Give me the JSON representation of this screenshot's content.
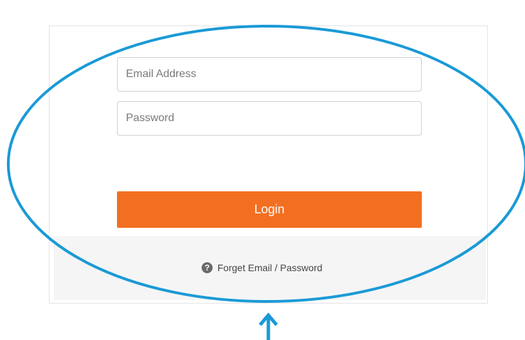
{
  "login_form": {
    "email_placeholder": "Email Address",
    "password_placeholder": "Password",
    "login_label": "Login",
    "forget_label": "Forget Email / Password",
    "help_icon": "question-circle-icon",
    "login_color": "#f26f21"
  },
  "annotation": {
    "color": "#1a9ad6",
    "shapes": [
      "ellipse-highlight",
      "arrow-up"
    ]
  }
}
